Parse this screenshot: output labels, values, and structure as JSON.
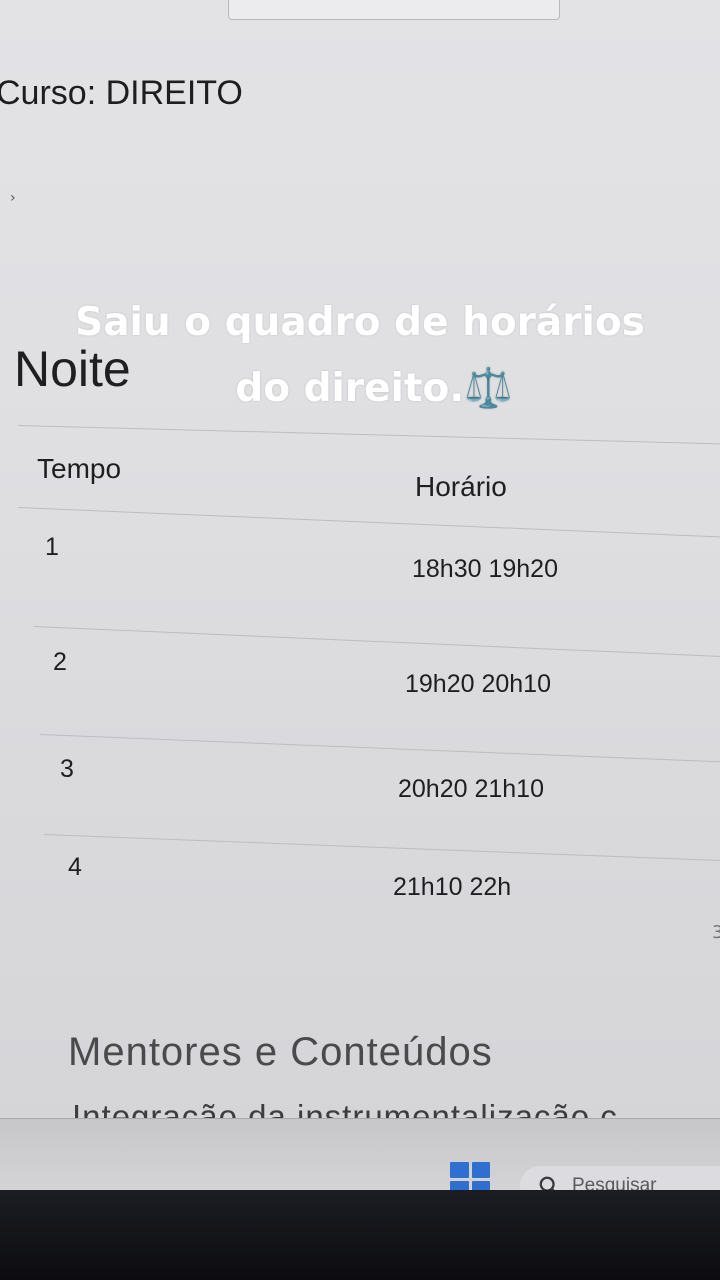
{
  "course": {
    "label": "Curso:",
    "value": "DIREITO"
  },
  "section": {
    "title": "Noite"
  },
  "caption": {
    "line1": "Saiu o quadro de horários",
    "line2": "do direito.⚖️"
  },
  "schedule": {
    "headers": {
      "tempo": "Tempo",
      "horario": "Horário"
    },
    "rows": [
      {
        "tempo": "1",
        "horario": "18h30 19h20"
      },
      {
        "tempo": "2",
        "horario": "19h20 20h10"
      },
      {
        "tempo": "3",
        "horario": "20h20 21h10"
      },
      {
        "tempo": "4",
        "horario": "21h10 22h"
      }
    ]
  },
  "mentors": {
    "title": "Mentores e Conteúdos",
    "first_item_partial": "Integração da instrumentalização c"
  },
  "taskbar": {
    "start_icon": "windows-start-icon",
    "search_icon": "search-icon",
    "search_label": "Pesquisar",
    "accent": "#2f6fd0"
  }
}
